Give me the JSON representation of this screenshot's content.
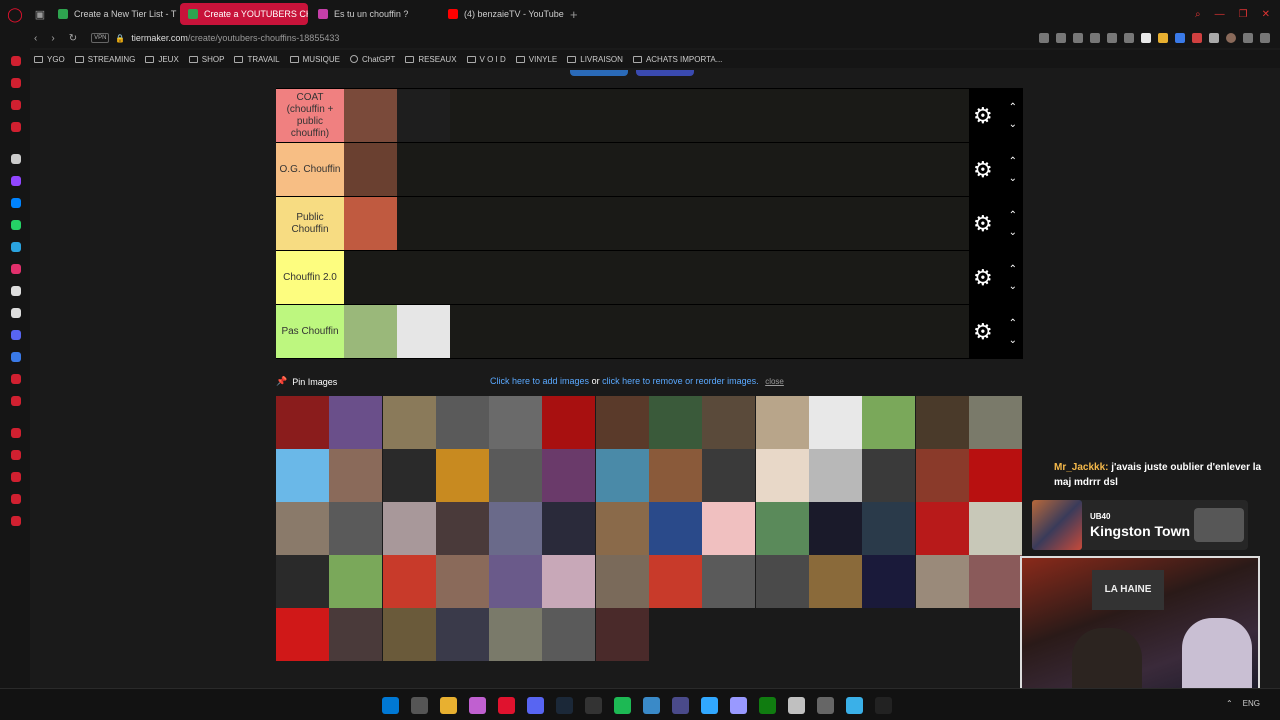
{
  "browser": {
    "tabs": [
      {
        "title": "Create a New Tier List - T",
        "active": false,
        "favicon_color": "#2ea44f"
      },
      {
        "title": "Create a YOUTUBERS CH",
        "active": true,
        "favicon_color": "#2ea44f"
      },
      {
        "title": "Es tu un chouffin ?",
        "active": false,
        "favicon_color": "#c53fa8"
      },
      {
        "title": "(4) benzaieTV - YouTube",
        "active": false,
        "favicon_color": "#ff0000"
      }
    ],
    "new_tab": "+",
    "url_domain": "tiermaker.com",
    "url_path": "/create/youtubers-chouffins-18855433",
    "vpn_badge": "VPN",
    "bookmarks": [
      {
        "label": "YGO",
        "icon": "folder-icon"
      },
      {
        "label": "STREAMING",
        "icon": "folder-icon"
      },
      {
        "label": "JEUX",
        "icon": "folder-icon"
      },
      {
        "label": "SHOP",
        "icon": "folder-icon"
      },
      {
        "label": "TRAVAIL",
        "icon": "folder-icon"
      },
      {
        "label": "MUSIQUE",
        "icon": "folder-icon"
      },
      {
        "label": "ChatGPT",
        "icon": "chatgpt-icon"
      },
      {
        "label": "RESEAUX",
        "icon": "folder-icon"
      },
      {
        "label": "V O I D",
        "icon": "folder-icon"
      },
      {
        "label": "VINYLE",
        "icon": "folder-icon"
      },
      {
        "label": "LIVRAISON",
        "icon": "folder-icon"
      },
      {
        "label": "ACHATS IMPORTA...",
        "icon": "folder-icon"
      }
    ]
  },
  "tiers": [
    {
      "label": "COAT (chouffin + public chouffin)",
      "color": "#f08080",
      "items": [
        "#7a4a3a",
        "#1e1e1e"
      ]
    },
    {
      "label": "O.G. Chouffin",
      "color": "#f7be84",
      "items": [
        "#6a4030"
      ]
    },
    {
      "label": "Public Chouffin",
      "color": "#f7dc82",
      "items": [
        "#c05a40"
      ]
    },
    {
      "label": "Chouffin 2.0",
      "color": "#fdfd7f",
      "items": []
    },
    {
      "label": "Pas Chouffin",
      "color": "#bdf77f",
      "items": [
        "#9ab87a",
        "#e6e6e6"
      ]
    }
  ],
  "pin": {
    "label": "Pin Images",
    "add_link": "Click here to add images",
    "or_text": "or",
    "remove_link": "click here to remove or reorder images.",
    "close": "close"
  },
  "pool_colors": [
    "#8a1c1c",
    "#6a4f8a",
    "#8a7a5a",
    "#5a5a5a",
    "#6a6a6a",
    "#a81010",
    "#5a3a2a",
    "#3a5a3a",
    "#5a4a3a",
    "#b8a58a",
    "#e8e8e8",
    "#7aa85a",
    "#4a3a2a",
    "#7a7a6a",
    "#6ab8e8",
    "#8a6a5a",
    "#2a2a2a",
    "#c88a20",
    "#5a5a5a",
    "#6a3a6a",
    "#4a8aa8",
    "#8a5a3a",
    "#3a3a3a",
    "#e8d8c8",
    "#b8b8b8",
    "#3a3a3a",
    "#8a3a2a",
    "#b81010",
    "#8a7a6a",
    "#5a5a5a",
    "#a8989a",
    "#4a3a3a",
    "#6a6a8a",
    "#2a2a3a",
    "#8a6a4a",
    "#2a4a8a",
    "#f0c0c0",
    "#5a8a5a",
    "#1a1a2a",
    "#2a3a4a",
    "#b81a1a",
    "#c8c8b8",
    "#2a2a2a",
    "#7aa85a",
    "#c83a2a",
    "#8a6a5a",
    "#6a5a8a",
    "#c8a8b8",
    "#7a6a5a",
    "#c83a2a",
    "#5a5a5a",
    "#4a4a4a",
    "#8a6a3a",
    "#1a1a3a",
    "#9a8a7a",
    "#8a5a5a",
    "#d01818",
    "#4a3a3a",
    "#6a5a3a",
    "#3a3a4a",
    "#7a7a6a",
    "#5a5a5a",
    "#4a2a2a"
  ],
  "chat": {
    "user": "Mr_Jackkk:",
    "message": "j'avais juste oublier d'enlever la maj mdrrr dsl"
  },
  "now_playing": {
    "artist": "UB40",
    "song": "Kingston Town"
  },
  "webcam": {
    "poster_text": "LA HAINE"
  },
  "taskbar": {
    "lang": "ENG",
    "icons": [
      "#0078d4",
      "#555555",
      "#e8b030",
      "#c060d0",
      "#e0122e",
      "#5865f2",
      "#1b2838",
      "#333333",
      "#1db954",
      "#3a8ac8",
      "#4a4a8a",
      "#31a8ff",
      "#9999ff",
      "#107c10",
      "#c0c0c0",
      "#666666",
      "#3ab0e8",
      "#222222"
    ]
  }
}
